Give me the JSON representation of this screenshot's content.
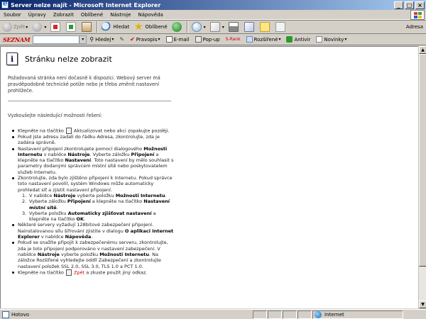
{
  "window": {
    "title": "Server nelze najít - Microsoft Internet Explorer"
  },
  "menu": [
    "Soubor",
    "Úpravy",
    "Zobrazit",
    "Oblíbené",
    "Nástroje",
    "Nápověda"
  ],
  "toolbar": {
    "back_label": "Zpět",
    "search_label": "Hledat",
    "favorites_label": "Oblíbené",
    "address_label": "Adresa"
  },
  "seznam": {
    "logo": "SEZNAM",
    "search_label": "Hledej",
    "spelling_label": "Pravopis",
    "email_label": "E-mail",
    "popup_label": "Pop-up",
    "srank_label": "S-Rank",
    "extended_label": "Rozšířené",
    "antivir_label": "Antivir",
    "news_label": "Novinky"
  },
  "page": {
    "title": "Stránku nelze zobrazit",
    "intro": "Požadovaná stránka není dočasně k dispozici. Webový server má pravděpodobně technické potíže nebo je třeba změnit nastavení prohlížeče.",
    "try_heading": "Vyzkoušejte následující možnosti řešení:",
    "items": {
      "i1_a": "Klepněte na tlačítko",
      "i1_b": "Aktualizovat nebo akci zopakujte později.",
      "i2": "Pokud jste adresu zadali do řádku Adresa, zkontrolujte, zda je zadána správně.",
      "i3_a": "Nastavení připojení zkontrolujete pomocí dialogového",
      "i3_b1": "Možnosti Internetu",
      "i3_c": "v nabídce",
      "i3_b2": "Nástroje",
      "i3_d": ". Vyberte záložku",
      "i3_b3": "Připojení",
      "i3_e": "a klepněte na tlačítko",
      "i3_b4": "Nastavení",
      "i3_f": ". Toto nastavení by mělo souhlasit s parametry dodanými správcem místní sítě nebo poskytovatelem služeb Internetu.",
      "i4": "Zkontrolujte, zda bylo zjištěno připojení k Internetu. Pokud správce toto nastavení povolil, systém Windows může automaticky prohledat síť a zjistit nastavení připojení.",
      "s1_a": "V nabídce",
      "s1_b": "Nástroje",
      "s1_c": "vyberte položku",
      "s1_d": "Možnosti Internetu",
      "s2_a": "Vyberte záložku",
      "s2_b": "Připojení",
      "s2_c": "a klepněte na tlačítko",
      "s2_d": "Nastavení místní sítě",
      "s3_a": "Vyberte položku",
      "s3_b": "Automaticky zjišťovat nastavení",
      "s3_c": "a klepněte na tlačítko",
      "s3_d": "OK",
      "i5_a": "Některé servery vyžadují 128bitové zabezpečení připojení. Nainstalovanou sílu šifrování zjistíte v dialogu",
      "i5_b": "O aplikaci Internet Explorer",
      "i5_c": "v nabídce",
      "i5_d": "Nápověda",
      "i6_a": "Pokud se snažíte připojit k zabezpečenému serveru, zkontrolujte, zda je toto připojení podporováno v nastavení zabezpečení. V nabídce",
      "i6_b": "Nástroje",
      "i6_c": "vyberte položku",
      "i6_d": "Možnosti Internetu",
      "i6_e": ". Na záložce Rozšířené vyhledejte oddíl Zabezpečení a zkontrolujte nastavení položek SSL 2.0, SSL 3.0, TLS 1.0 a PCT 1.0.",
      "i7_a": "Klepněte na tlačítko",
      "i7_b": "Zpět",
      "i7_c": "a zkuste použít jiný odkaz."
    }
  },
  "status": {
    "text": "Hotovo",
    "zone": "Internet"
  }
}
